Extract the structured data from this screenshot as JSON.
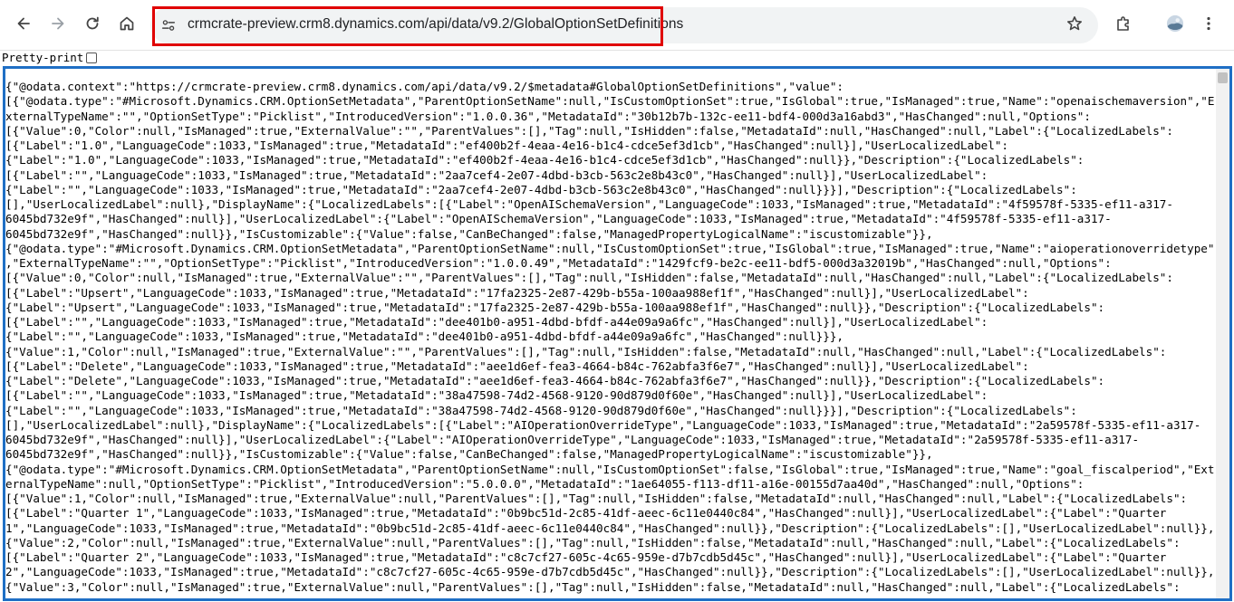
{
  "toolbar": {
    "url": "crmcrate-preview.crm8.dynamics.com/api/data/v9.2/GlobalOptionSetDefinitions",
    "icons": [
      "back-icon",
      "forward-icon",
      "reload-icon",
      "home-icon",
      "site-info-icon",
      "star-icon",
      "extensions-icon",
      "profile-avatar",
      "menu-icon"
    ],
    "highlight_color": "#e00000"
  },
  "pretty_print": {
    "label": "Pretty-print",
    "checked": false
  },
  "json_panel": {
    "border_color": "#1f6fc5",
    "lines": [
      "{\"@odata.context\":\"https://crmcrate-preview.crm8.dynamics.com/api/data/v9.2/$metadata#GlobalOptionSetDefinitions\",\"value\":",
      "[{\"@odata.type\":\"#Microsoft.Dynamics.CRM.OptionSetMetadata\",\"ParentOptionSetName\":null,\"IsCustomOptionSet\":true,\"IsGlobal\":true,\"IsManaged\":true,\"Name\":\"openaischemaversion\",\"E",
      "xternalTypeName\":\"\",\"OptionSetType\":\"Picklist\",\"IntroducedVersion\":\"1.0.0.36\",\"MetadataId\":\"30b12b7b-132c-ee11-bdf4-000d3a16abd3\",\"HasChanged\":null,\"Options\":",
      "[{\"Value\":0,\"Color\":null,\"IsManaged\":true,\"ExternalValue\":\"\",\"ParentValues\":[],\"Tag\":null,\"IsHidden\":false,\"MetadataId\":null,\"HasChanged\":null,\"Label\":{\"LocalizedLabels\":",
      "[{\"Label\":\"1.0\",\"LanguageCode\":1033,\"IsManaged\":true,\"MetadataId\":\"ef400b2f-4eaa-4e16-b1c4-cdce5ef3d1cb\",\"HasChanged\":null}],\"UserLocalizedLabel\":",
      "{\"Label\":\"1.0\",\"LanguageCode\":1033,\"IsManaged\":true,\"MetadataId\":\"ef400b2f-4eaa-4e16-b1c4-cdce5ef3d1cb\",\"HasChanged\":null}},\"Description\":{\"LocalizedLabels\":",
      "[{\"Label\":\"\",\"LanguageCode\":1033,\"IsManaged\":true,\"MetadataId\":\"2aa7cef4-2e07-4dbd-b3cb-563c2e8b43c0\",\"HasChanged\":null}],\"UserLocalizedLabel\":",
      "{\"Label\":\"\",\"LanguageCode\":1033,\"IsManaged\":true,\"MetadataId\":\"2aa7cef4-2e07-4dbd-b3cb-563c2e8b43c0\",\"HasChanged\":null}}}],\"Description\":{\"LocalizedLabels\":",
      "[],\"UserLocalizedLabel\":null},\"DisplayName\":{\"LocalizedLabels\":[{\"Label\":\"OpenAISchemaVersion\",\"LanguageCode\":1033,\"IsManaged\":true,\"MetadataId\":\"4f59578f-5335-ef11-a317-",
      "6045bd732e9f\",\"HasChanged\":null}],\"UserLocalizedLabel\":{\"Label\":\"OpenAISchemaVersion\",\"LanguageCode\":1033,\"IsManaged\":true,\"MetadataId\":\"4f59578f-5335-ef11-a317-",
      "6045bd732e9f\",\"HasChanged\":null}},\"IsCustomizable\":{\"Value\":false,\"CanBeChanged\":false,\"ManagedPropertyLogicalName\":\"iscustomizable\"}},",
      "{\"@odata.type\":\"#Microsoft.Dynamics.CRM.OptionSetMetadata\",\"ParentOptionSetName\":null,\"IsCustomOptionSet\":true,\"IsGlobal\":true,\"IsManaged\":true,\"Name\":\"aioperationoverridetype\"",
      ",\"ExternalTypeName\":\"\",\"OptionSetType\":\"Picklist\",\"IntroducedVersion\":\"1.0.0.49\",\"MetadataId\":\"1429fcf9-be2c-ee11-bdf5-000d3a32019b\",\"HasChanged\":null,\"Options\":",
      "[{\"Value\":0,\"Color\":null,\"IsManaged\":true,\"ExternalValue\":\"\",\"ParentValues\":[],\"Tag\":null,\"IsHidden\":false,\"MetadataId\":null,\"HasChanged\":null,\"Label\":{\"LocalizedLabels\":",
      "[{\"Label\":\"Upsert\",\"LanguageCode\":1033,\"IsManaged\":true,\"MetadataId\":\"17fa2325-2e87-429b-b55a-100aa988ef1f\",\"HasChanged\":null}],\"UserLocalizedLabel\":",
      "{\"Label\":\"Upsert\",\"LanguageCode\":1033,\"IsManaged\":true,\"MetadataId\":\"17fa2325-2e87-429b-b55a-100aa988ef1f\",\"HasChanged\":null}},\"Description\":{\"LocalizedLabels\":",
      "[{\"Label\":\"\",\"LanguageCode\":1033,\"IsManaged\":true,\"MetadataId\":\"dee401b0-a951-4dbd-bfdf-a44e09a9a6fc\",\"HasChanged\":null}],\"UserLocalizedLabel\":",
      "{\"Label\":\"\",\"LanguageCode\":1033,\"IsManaged\":true,\"MetadataId\":\"dee401b0-a951-4dbd-bfdf-a44e09a9a6fc\",\"HasChanged\":null}}},",
      "{\"Value\":1,\"Color\":null,\"IsManaged\":true,\"ExternalValue\":\"\",\"ParentValues\":[],\"Tag\":null,\"IsHidden\":false,\"MetadataId\":null,\"HasChanged\":null,\"Label\":{\"LocalizedLabels\":",
      "[{\"Label\":\"Delete\",\"LanguageCode\":1033,\"IsManaged\":true,\"MetadataId\":\"aee1d6ef-fea3-4664-b84c-762abfa3f6e7\",\"HasChanged\":null}],\"UserLocalizedLabel\":",
      "{\"Label\":\"Delete\",\"LanguageCode\":1033,\"IsManaged\":true,\"MetadataId\":\"aee1d6ef-fea3-4664-b84c-762abfa3f6e7\",\"HasChanged\":null}},\"Description\":{\"LocalizedLabels\":",
      "[{\"Label\":\"\",\"LanguageCode\":1033,\"IsManaged\":true,\"MetadataId\":\"38a47598-74d2-4568-9120-90d879d0f60e\",\"HasChanged\":null}],\"UserLocalizedLabel\":",
      "{\"Label\":\"\",\"LanguageCode\":1033,\"IsManaged\":true,\"MetadataId\":\"38a47598-74d2-4568-9120-90d879d0f60e\",\"HasChanged\":null}}}],\"Description\":{\"LocalizedLabels\":",
      "[],\"UserLocalizedLabel\":null},\"DisplayName\":{\"LocalizedLabels\":[{\"Label\":\"AIOperationOverrideType\",\"LanguageCode\":1033,\"IsManaged\":true,\"MetadataId\":\"2a59578f-5335-ef11-a317-",
      "6045bd732e9f\",\"HasChanged\":null}],\"UserLocalizedLabel\":{\"Label\":\"AIOperationOverrideType\",\"LanguageCode\":1033,\"IsManaged\":true,\"MetadataId\":\"2a59578f-5335-ef11-a317-",
      "6045bd732e9f\",\"HasChanged\":null}},\"IsCustomizable\":{\"Value\":false,\"CanBeChanged\":false,\"ManagedPropertyLogicalName\":\"iscustomizable\"}},",
      "{\"@odata.type\":\"#Microsoft.Dynamics.CRM.OptionSetMetadata\",\"ParentOptionSetName\":null,\"IsCustomOptionSet\":false,\"IsGlobal\":true,\"IsManaged\":true,\"Name\":\"goal_fiscalperiod\",\"Ext",
      "ernalTypeName\":null,\"OptionSetType\":\"Picklist\",\"IntroducedVersion\":\"5.0.0.0\",\"MetadataId\":\"1ae64055-f113-df11-a16e-00155d7aa40d\",\"HasChanged\":null,\"Options\":",
      "[{\"Value\":1,\"Color\":null,\"IsManaged\":true,\"ExternalValue\":null,\"ParentValues\":[],\"Tag\":null,\"IsHidden\":false,\"MetadataId\":null,\"HasChanged\":null,\"Label\":{\"LocalizedLabels\":",
      "[{\"Label\":\"Quarter 1\",\"LanguageCode\":1033,\"IsManaged\":true,\"MetadataId\":\"0b9bc51d-2c85-41df-aeec-6c11e0440c84\",\"HasChanged\":null}],\"UserLocalizedLabel\":{\"Label\":\"Quarter",
      "1\",\"LanguageCode\":1033,\"IsManaged\":true,\"MetadataId\":\"0b9bc51d-2c85-41df-aeec-6c11e0440c84\",\"HasChanged\":null}},\"Description\":{\"LocalizedLabels\":[],\"UserLocalizedLabel\":null}},",
      "{\"Value\":2,\"Color\":null,\"IsManaged\":true,\"ExternalValue\":null,\"ParentValues\":[],\"Tag\":null,\"IsHidden\":false,\"MetadataId\":null,\"HasChanged\":null,\"Label\":{\"LocalizedLabels\":",
      "[{\"Label\":\"Quarter 2\",\"LanguageCode\":1033,\"IsManaged\":true,\"MetadataId\":\"c8c7cf27-605c-4c65-959e-d7b7cdb5d45c\",\"HasChanged\":null}],\"UserLocalizedLabel\":{\"Label\":\"Quarter",
      "2\",\"LanguageCode\":1033,\"IsManaged\":true,\"MetadataId\":\"c8c7cf27-605c-4c65-959e-d7b7cdb5d45c\",\"HasChanged\":null}},\"Description\":{\"LocalizedLabels\":[],\"UserLocalizedLabel\":null}},",
      "{\"Value\":3,\"Color\":null,\"IsManaged\":true,\"ExternalValue\":null,\"ParentValues\":[],\"Tag\":null,\"IsHidden\":false,\"MetadataId\":null,\"HasChanged\":null,\"Label\":{\"LocalizedLabels\":"
    ]
  }
}
